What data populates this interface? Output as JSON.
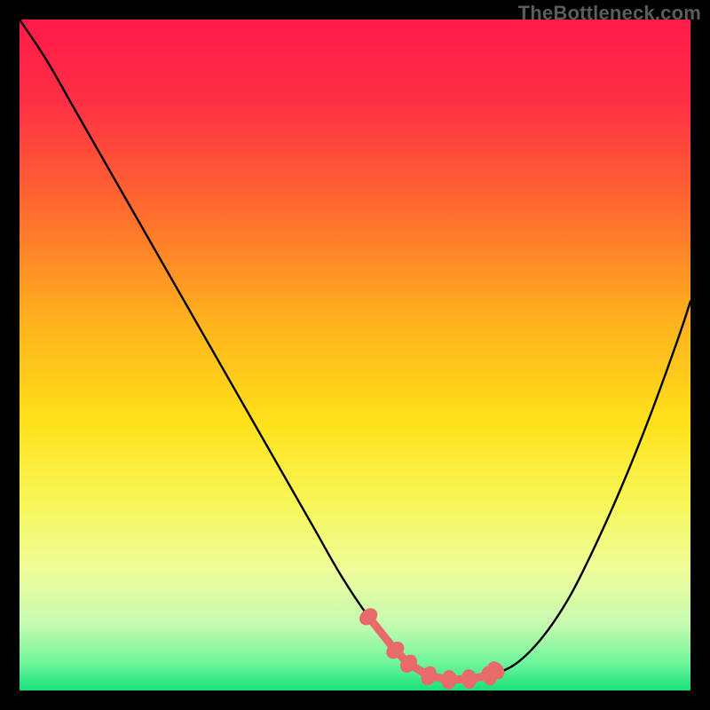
{
  "attribution": "TheBottleneck.com",
  "colors": {
    "frame": "#000000",
    "curve": "#000000",
    "marker": "#e86a6a",
    "gradient_stops": [
      {
        "offset": 0.0,
        "color": "#ff1a4b"
      },
      {
        "offset": 0.12,
        "color": "#ff2f45"
      },
      {
        "offset": 0.28,
        "color": "#ff6a2f"
      },
      {
        "offset": 0.45,
        "color": "#ffb21d"
      },
      {
        "offset": 0.6,
        "color": "#ffe11a"
      },
      {
        "offset": 0.72,
        "color": "#f8f758"
      },
      {
        "offset": 0.82,
        "color": "#eefc9a"
      },
      {
        "offset": 0.9,
        "color": "#c7fbb0"
      },
      {
        "offset": 0.96,
        "color": "#6ef59a"
      },
      {
        "offset": 1.0,
        "color": "#17e07a"
      }
    ]
  },
  "chart_data": {
    "type": "line",
    "title": "",
    "xlabel": "",
    "ylabel": "",
    "xlim": [
      0,
      100
    ],
    "ylim": [
      0,
      100
    ],
    "x": [
      0,
      4,
      8,
      12,
      16,
      20,
      24,
      28,
      32,
      36,
      40,
      44,
      48,
      52,
      56,
      60,
      62,
      64,
      66,
      68,
      70,
      74,
      78,
      82,
      86,
      90,
      94,
      98,
      100
    ],
    "values": [
      100,
      94,
      87,
      80,
      73,
      66,
      59,
      52,
      45,
      38,
      31,
      24,
      17,
      11,
      6,
      3,
      2,
      1.6,
      1.5,
      1.7,
      2.2,
      4,
      8,
      14,
      22,
      31,
      41,
      52,
      58
    ],
    "markers_x": [
      52,
      56,
      58,
      61,
      64,
      67,
      70,
      71
    ],
    "markers_y": [
      11,
      6,
      4,
      2.2,
      1.6,
      1.7,
      2.2,
      3.0
    ]
  }
}
